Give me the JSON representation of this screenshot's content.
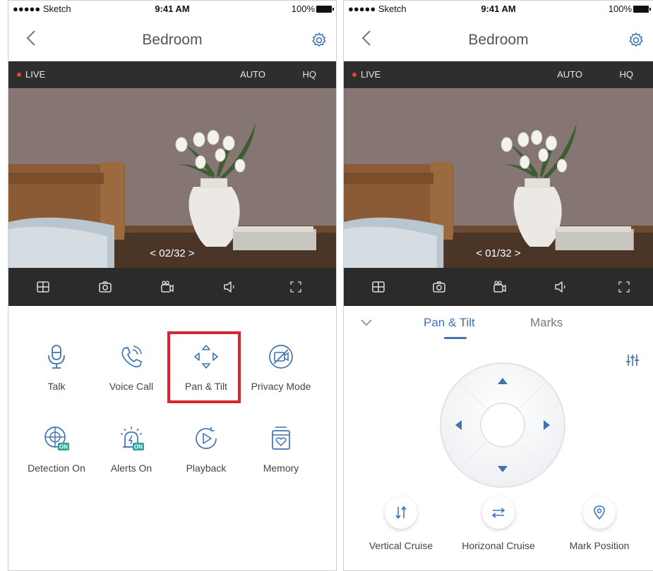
{
  "status": {
    "carrier": "●●●●● Sketch",
    "time": "9:41 AM",
    "battery": "100%"
  },
  "left": {
    "title": "Bedroom",
    "live": "LIVE",
    "auto": "AUTO",
    "hq": "HQ",
    "counter": "<  02/32  >",
    "features": [
      {
        "label": "Talk",
        "icon": "microphone-icon"
      },
      {
        "label": "Voice Call",
        "icon": "phone-icon"
      },
      {
        "label": "Pan & Tilt",
        "icon": "pan-tilt-icon"
      },
      {
        "label": "Privacy Mode",
        "icon": "privacy-camera-off-icon"
      },
      {
        "label": "Detection On",
        "icon": "detection-icon",
        "badge": "ON"
      },
      {
        "label": "Alerts On",
        "icon": "alarm-icon",
        "badge": "ON"
      },
      {
        "label": "Playback",
        "icon": "playback-icon"
      },
      {
        "label": "Memory",
        "icon": "memory-card-icon"
      }
    ]
  },
  "right": {
    "title": "Bedroom",
    "live": "LIVE",
    "auto": "AUTO",
    "hq": "HQ",
    "counter": "<  01/32  >",
    "tabs": [
      "Pan & Tilt",
      "Marks"
    ],
    "actions": [
      {
        "label": "Vertical Cruise",
        "icon": "vertical-arrows-icon"
      },
      {
        "label": "Horizonal Cruise",
        "icon": "horizontal-arrows-icon"
      },
      {
        "label": "Mark Position",
        "icon": "location-pin-icon"
      }
    ]
  },
  "colors": {
    "accent": "#3e74b5",
    "highlight": "#d9262c",
    "dark_bar": "#2e2e2e",
    "live_dot": "#e0463a"
  }
}
